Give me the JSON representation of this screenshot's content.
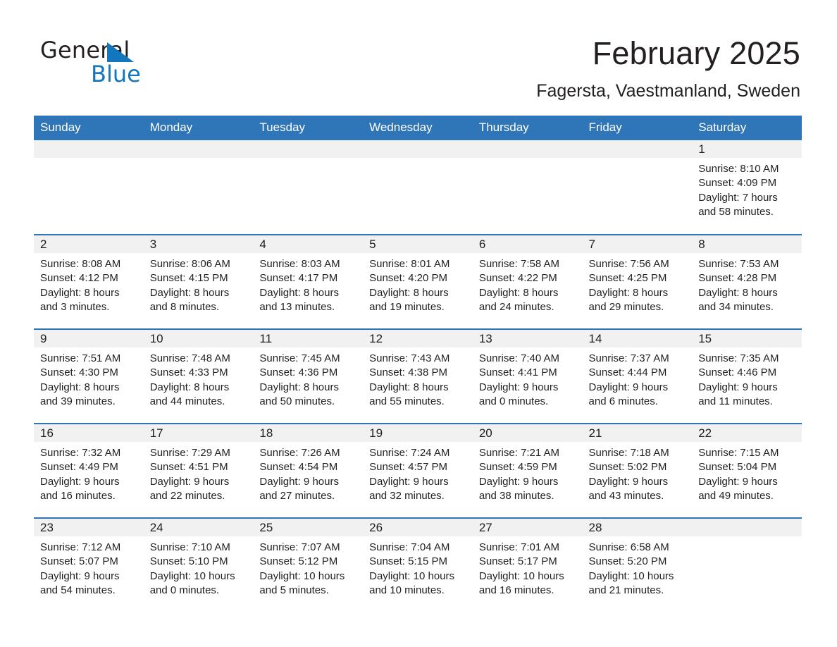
{
  "brand": {
    "name_part1": "General",
    "name_part2": "Blue",
    "accent_color": "#1476bd"
  },
  "header": {
    "title": "February 2025",
    "location": "Fagersta, Vaestmanland, Sweden"
  },
  "calendar": {
    "header_color": "#2e76b8",
    "daynum_bg": "#f1f1f1",
    "weekdays": [
      "Sunday",
      "Monday",
      "Tuesday",
      "Wednesday",
      "Thursday",
      "Friday",
      "Saturday"
    ],
    "weeks": [
      [
        {
          "day": "",
          "lines": []
        },
        {
          "day": "",
          "lines": []
        },
        {
          "day": "",
          "lines": []
        },
        {
          "day": "",
          "lines": []
        },
        {
          "day": "",
          "lines": []
        },
        {
          "day": "",
          "lines": []
        },
        {
          "day": "1",
          "lines": [
            "Sunrise: 8:10 AM",
            "Sunset: 4:09 PM",
            "Daylight: 7 hours",
            "and 58 minutes."
          ]
        }
      ],
      [
        {
          "day": "2",
          "lines": [
            "Sunrise: 8:08 AM",
            "Sunset: 4:12 PM",
            "Daylight: 8 hours",
            "and 3 minutes."
          ]
        },
        {
          "day": "3",
          "lines": [
            "Sunrise: 8:06 AM",
            "Sunset: 4:15 PM",
            "Daylight: 8 hours",
            "and 8 minutes."
          ]
        },
        {
          "day": "4",
          "lines": [
            "Sunrise: 8:03 AM",
            "Sunset: 4:17 PM",
            "Daylight: 8 hours",
            "and 13 minutes."
          ]
        },
        {
          "day": "5",
          "lines": [
            "Sunrise: 8:01 AM",
            "Sunset: 4:20 PM",
            "Daylight: 8 hours",
            "and 19 minutes."
          ]
        },
        {
          "day": "6",
          "lines": [
            "Sunrise: 7:58 AM",
            "Sunset: 4:22 PM",
            "Daylight: 8 hours",
            "and 24 minutes."
          ]
        },
        {
          "day": "7",
          "lines": [
            "Sunrise: 7:56 AM",
            "Sunset: 4:25 PM",
            "Daylight: 8 hours",
            "and 29 minutes."
          ]
        },
        {
          "day": "8",
          "lines": [
            "Sunrise: 7:53 AM",
            "Sunset: 4:28 PM",
            "Daylight: 8 hours",
            "and 34 minutes."
          ]
        }
      ],
      [
        {
          "day": "9",
          "lines": [
            "Sunrise: 7:51 AM",
            "Sunset: 4:30 PM",
            "Daylight: 8 hours",
            "and 39 minutes."
          ]
        },
        {
          "day": "10",
          "lines": [
            "Sunrise: 7:48 AM",
            "Sunset: 4:33 PM",
            "Daylight: 8 hours",
            "and 44 minutes."
          ]
        },
        {
          "day": "11",
          "lines": [
            "Sunrise: 7:45 AM",
            "Sunset: 4:36 PM",
            "Daylight: 8 hours",
            "and 50 minutes."
          ]
        },
        {
          "day": "12",
          "lines": [
            "Sunrise: 7:43 AM",
            "Sunset: 4:38 PM",
            "Daylight: 8 hours",
            "and 55 minutes."
          ]
        },
        {
          "day": "13",
          "lines": [
            "Sunrise: 7:40 AM",
            "Sunset: 4:41 PM",
            "Daylight: 9 hours",
            "and 0 minutes."
          ]
        },
        {
          "day": "14",
          "lines": [
            "Sunrise: 7:37 AM",
            "Sunset: 4:44 PM",
            "Daylight: 9 hours",
            "and 6 minutes."
          ]
        },
        {
          "day": "15",
          "lines": [
            "Sunrise: 7:35 AM",
            "Sunset: 4:46 PM",
            "Daylight: 9 hours",
            "and 11 minutes."
          ]
        }
      ],
      [
        {
          "day": "16",
          "lines": [
            "Sunrise: 7:32 AM",
            "Sunset: 4:49 PM",
            "Daylight: 9 hours",
            "and 16 minutes."
          ]
        },
        {
          "day": "17",
          "lines": [
            "Sunrise: 7:29 AM",
            "Sunset: 4:51 PM",
            "Daylight: 9 hours",
            "and 22 minutes."
          ]
        },
        {
          "day": "18",
          "lines": [
            "Sunrise: 7:26 AM",
            "Sunset: 4:54 PM",
            "Daylight: 9 hours",
            "and 27 minutes."
          ]
        },
        {
          "day": "19",
          "lines": [
            "Sunrise: 7:24 AM",
            "Sunset: 4:57 PM",
            "Daylight: 9 hours",
            "and 32 minutes."
          ]
        },
        {
          "day": "20",
          "lines": [
            "Sunrise: 7:21 AM",
            "Sunset: 4:59 PM",
            "Daylight: 9 hours",
            "and 38 minutes."
          ]
        },
        {
          "day": "21",
          "lines": [
            "Sunrise: 7:18 AM",
            "Sunset: 5:02 PM",
            "Daylight: 9 hours",
            "and 43 minutes."
          ]
        },
        {
          "day": "22",
          "lines": [
            "Sunrise: 7:15 AM",
            "Sunset: 5:04 PM",
            "Daylight: 9 hours",
            "and 49 minutes."
          ]
        }
      ],
      [
        {
          "day": "23",
          "lines": [
            "Sunrise: 7:12 AM",
            "Sunset: 5:07 PM",
            "Daylight: 9 hours",
            "and 54 minutes."
          ]
        },
        {
          "day": "24",
          "lines": [
            "Sunrise: 7:10 AM",
            "Sunset: 5:10 PM",
            "Daylight: 10 hours",
            "and 0 minutes."
          ]
        },
        {
          "day": "25",
          "lines": [
            "Sunrise: 7:07 AM",
            "Sunset: 5:12 PM",
            "Daylight: 10 hours",
            "and 5 minutes."
          ]
        },
        {
          "day": "26",
          "lines": [
            "Sunrise: 7:04 AM",
            "Sunset: 5:15 PM",
            "Daylight: 10 hours",
            "and 10 minutes."
          ]
        },
        {
          "day": "27",
          "lines": [
            "Sunrise: 7:01 AM",
            "Sunset: 5:17 PM",
            "Daylight: 10 hours",
            "and 16 minutes."
          ]
        },
        {
          "day": "28",
          "lines": [
            "Sunrise: 6:58 AM",
            "Sunset: 5:20 PM",
            "Daylight: 10 hours",
            "and 21 minutes."
          ]
        },
        {
          "day": "",
          "lines": []
        }
      ]
    ]
  }
}
